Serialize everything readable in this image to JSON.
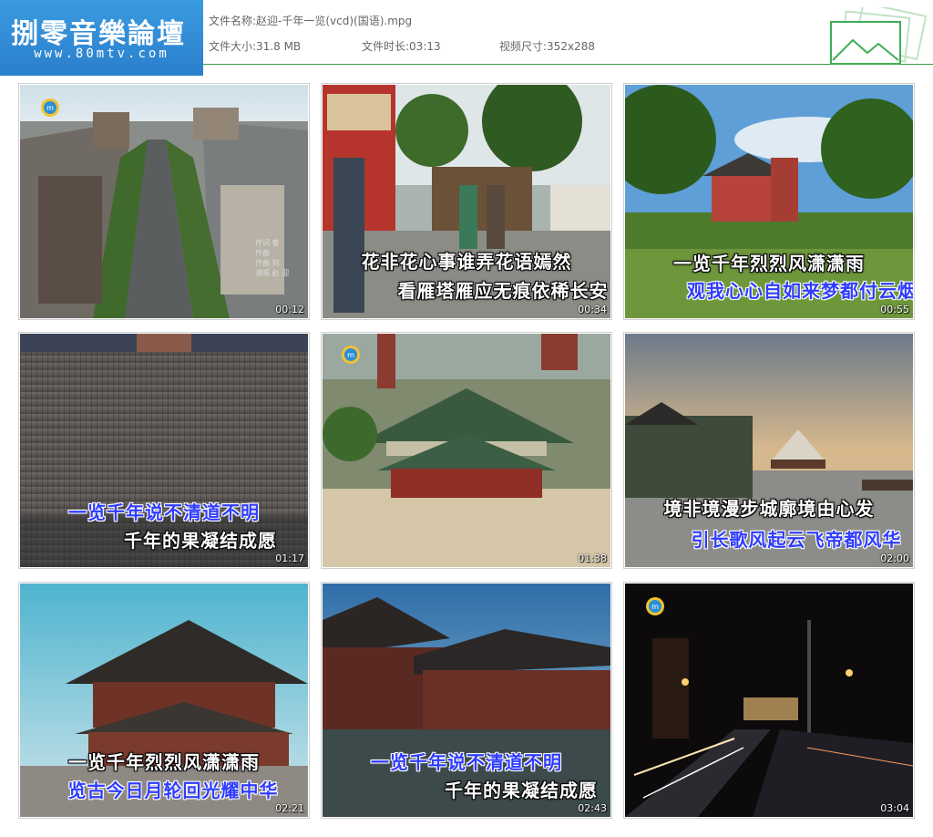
{
  "logo": {
    "title": "捌零音樂論壇",
    "url": "www.80mtv.com"
  },
  "file": {
    "name_label": "文件名称:",
    "name": "赵迎-千年一览(vcd)(国语).mpg",
    "size_label": "文件大小:",
    "size": "31.8 MB",
    "duration_label": "文件时长:",
    "duration": "03:13",
    "resolution_label": "视频尺寸:",
    "resolution": "352x288"
  },
  "thumbnails": [
    {
      "time": "00:12",
      "credits": [
        "作词 曹",
        "作曲",
        "作曲 刘",
        "演唱 赵 迎"
      ]
    },
    {
      "time": "00:34",
      "lyric1": "花非花心事谁弄花语嫣然",
      "lyric2": "看雁塔雁应无痕依稀长安"
    },
    {
      "time": "00:55",
      "lyric1": "一览千年烈烈风潇潇雨",
      "lyric2": "观我心心自如来梦都付云烟"
    },
    {
      "time": "01:17",
      "lyric1": "一览千年说不清道不明",
      "lyric2": "千年的果凝结成愿"
    },
    {
      "time": "01:38"
    },
    {
      "time": "02:00",
      "lyric1": "境非境漫步城廓境由心发",
      "lyric2": "引长歌风起云飞帝都风华"
    },
    {
      "time": "02:21",
      "lyric1": "一览千年烈烈风潇潇雨",
      "lyric2": "览古今日月轮回光耀中华"
    },
    {
      "time": "02:43",
      "lyric1": "一览千年说不清道不明",
      "lyric2": "千年的果凝结成愿"
    },
    {
      "time": "03:04"
    }
  ],
  "colors": {
    "header_line": "#2f9e42",
    "logo_bg": "#2b7fcc",
    "lyric_blue": "#2f3cff"
  }
}
